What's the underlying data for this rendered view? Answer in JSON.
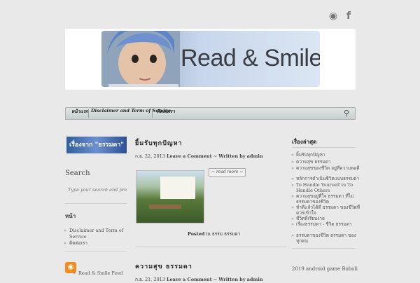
{
  "social": {
    "rss_icon": "rss-icon",
    "facebook_icon": "facebook-icon"
  },
  "header": {
    "title": "Read & Smile"
  },
  "nav": {
    "items": [
      "หน้าแรก",
      "Disclaimer and Term of Service",
      "ติดต่อเรา"
    ],
    "search_icon": "search-icon"
  },
  "left_sidebar": {
    "banner_text": "เรื่องจาก \"ธรรมดา\"",
    "search_heading": "Search",
    "search_placeholder": "Type your search and press",
    "pages_heading": "หน้า",
    "pages": [
      "Disclaimer and Term of Service",
      "ติดต่อเรา"
    ],
    "feed_label": "Read & Smile Feed"
  },
  "posts": [
    {
      "title": "ยิ้มรับทุกปัญหา",
      "meta_date": "ก.ย. 22, 2013",
      "meta_comment": "Leave a Comment",
      "meta_written": "Written by",
      "meta_author": "admin",
      "read_more": "~ read more ~",
      "posted_label": "Posted",
      "posted_in": "in",
      "category": "ธรรม ธรรมดา"
    },
    {
      "title": "ความสุข ธรรมดา",
      "meta_date": "ก.ย. 21, 2013",
      "meta_comment": "Leave a Comment",
      "meta_written": "Written by",
      "meta_author": "admin"
    }
  ],
  "right_sidebar": {
    "heading": "เรื่องล่าสุด",
    "recent": [
      "ยิ้มรับทุกปัญหา",
      "ความสุข ธรรมดา",
      "ความสุขของชีวิต อยู่ที่ความพอดี",
      "หลักการดำเนินชีวิตแบบธรรมดา",
      "To Handle Yourself vs To Handle Others",
      "ความสุขอยู่ที่ใจ ธรรมดา ที่ไม่ธรรมดาของชีวิต",
      "ทำดีแล้วได้ดี ธรรมดา ของชีวิตที่ควรเข้าใจ",
      "ชีวิตที่เรียบง่าย",
      "เรื่องธรรมดา - ชีวิต ธรรมดา",
      "ธรรมดาของชีวิต ธรรมดา ของทุกคน"
    ],
    "bottom_item": "2019 android game Boboli"
  }
}
